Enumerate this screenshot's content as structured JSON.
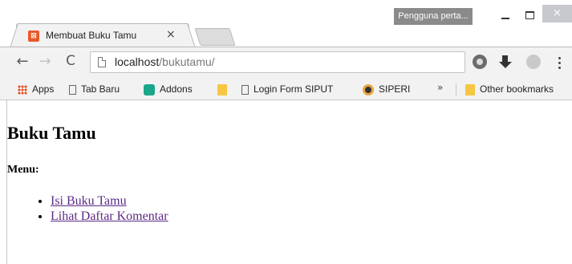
{
  "browser": {
    "tab_title": "Membuat Buku Tamu",
    "tab_close": "×",
    "profile_button": "Pengguna perta...",
    "close_glyph": "×",
    "url_host": "localhost",
    "url_path": "/bukutamu/"
  },
  "bookmarks": {
    "apps": "Apps",
    "tab_baru": "Tab Baru",
    "addons": "Addons",
    "login_form": "Login Form SIPUT",
    "siperi": "SIPERI",
    "more": "»",
    "other": "Other bookmarks"
  },
  "page": {
    "heading": "Buku Tamu",
    "menu_label": "Menu:",
    "links": [
      "Isi Buku Tamu",
      "Lihat Daftar Komentar"
    ]
  },
  "colors": {
    "link_visited": "#5b2a86",
    "favicon": "#e85a2a"
  },
  "icons": [
    "favicon-icon",
    "back-icon",
    "forward-icon",
    "reload-icon",
    "page-icon",
    "extension-film-icon",
    "download-icon",
    "globe-icon",
    "menu-icon",
    "apps-icon",
    "folder-icon",
    "puzzle-icon"
  ]
}
